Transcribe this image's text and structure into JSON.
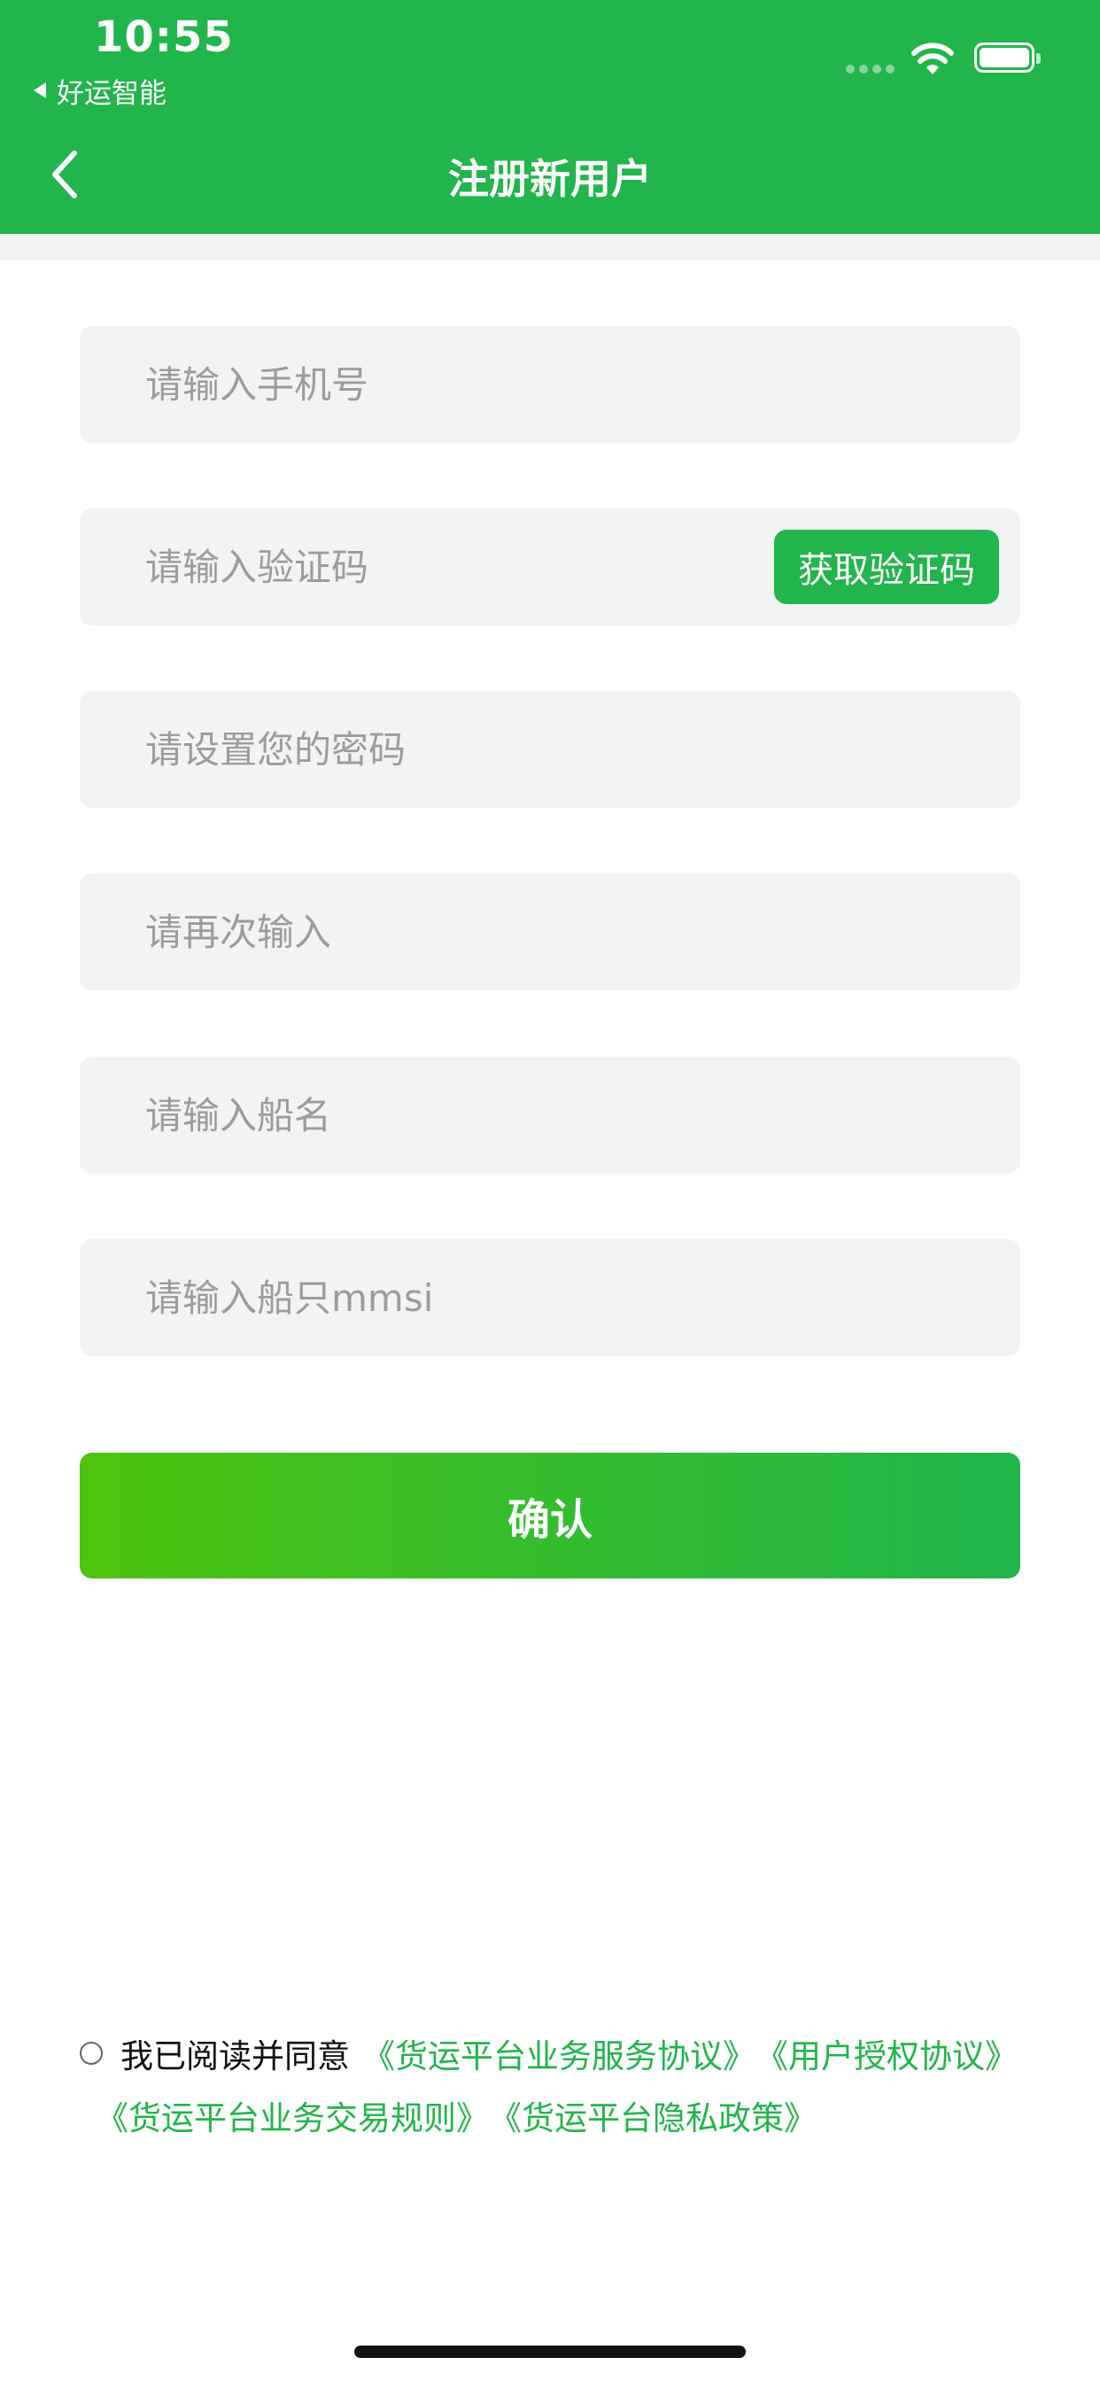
{
  "status_bar": {
    "time": "10:55",
    "back_app_label": "好运智能"
  },
  "nav": {
    "title": "注册新用户"
  },
  "form": {
    "phone_placeholder": "请输入手机号",
    "code_placeholder": "请输入验证码",
    "get_code_label": "获取验证码",
    "password_placeholder": "请设置您的密码",
    "password_confirm_placeholder": "请再次输入",
    "ship_name_placeholder": "请输入船名",
    "ship_mmsi_placeholder": "请输入船只mmsi",
    "confirm_label": "确认"
  },
  "agreement": {
    "checked": false,
    "prefix": "我已阅读并同意",
    "links": [
      "《货运平台业务服务协议》",
      "《用户授权协议》",
      "《货运平台业务交易规则》",
      "《货运平台隐私政策》"
    ]
  },
  "colors": {
    "brand_green": "#21b54b",
    "gradient_start": "#4fc40e",
    "field_bg": "#f1f4f2"
  },
  "icons": {
    "back": "chevron-left-icon",
    "wifi": "wifi-icon",
    "battery": "battery-icon"
  }
}
